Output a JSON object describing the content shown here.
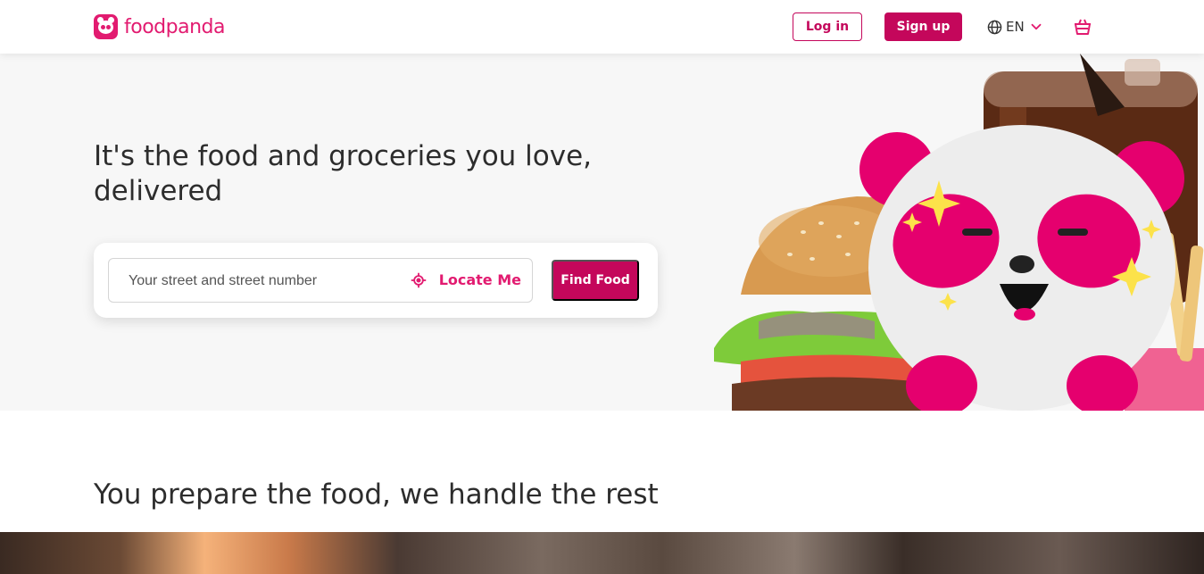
{
  "header": {
    "brand": "foodpanda",
    "login_label": "Log in",
    "signup_label": "Sign up",
    "language": "EN"
  },
  "hero": {
    "title": "It's the food and groceries you love, delivered",
    "search": {
      "placeholder": "Your street and street number",
      "value": "",
      "locate_label": "Locate Me"
    },
    "find_button_label": "Find Food"
  },
  "section": {
    "title": "You prepare the food, we handle the rest"
  },
  "icons": {
    "language": "globe-icon",
    "dropdown": "chevron-down-icon",
    "cart": "shopping-basket-icon",
    "locate": "crosshair-icon"
  },
  "colors": {
    "brand": "#e21b70",
    "button": "#c4075b",
    "hero_bg": "#f7f7f7"
  }
}
